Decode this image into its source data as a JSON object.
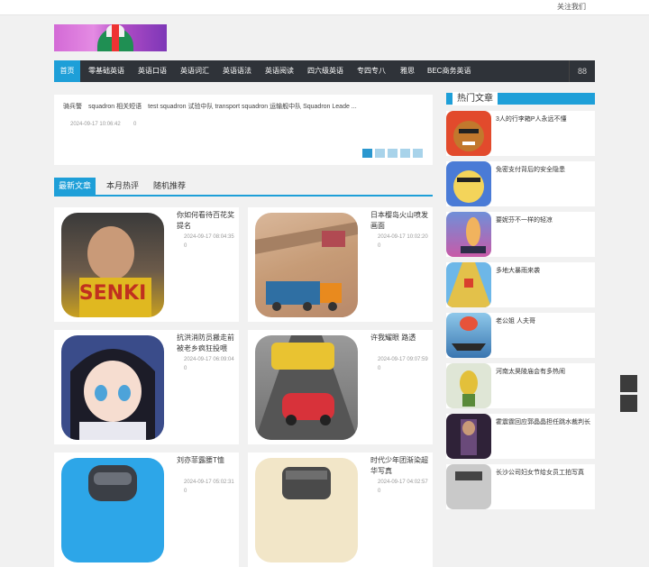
{
  "topbar": {
    "follow": "关注我们"
  },
  "nav": {
    "items": [
      "首页",
      "零基础英语",
      "英语口语",
      "英语词汇",
      "英语语法",
      "英语阅读",
      "四六级英语",
      "专四专八",
      "雅思",
      "BEC商务英语"
    ],
    "grid_icon": "grid-icon"
  },
  "slider": {
    "title": "骑兵警　squadron 相关短语　test squadron 试验中队 transport squadron 运输舰中队 Squadron Leade ...",
    "date": "2024-09-17 10:06:42",
    "count": "0",
    "dots": 5,
    "active_dot": 0
  },
  "tabs": [
    "最新文章",
    "本月热评",
    "随机推荐"
  ],
  "posts": [
    {
      "title": "你如何看待百花奖提名",
      "date": "2024-09-17 08:04:35",
      "count": "0"
    },
    {
      "title": "日本樱岛火山喷发画面",
      "date": "2024-09-17 10:02:20",
      "count": "0"
    },
    {
      "title": "抗洪消防员搬走前被老乡疯狂投喂",
      "date": "2024-09-17 06:09:04",
      "count": "0"
    },
    {
      "title": "许我耀眼 路透",
      "date": "2024-09-17 09:07:59",
      "count": "0"
    },
    {
      "title": "刘亦菲露腰T恤",
      "date": "2024-09-17 05:02:31",
      "count": "0"
    },
    {
      "title": "时代少年团渐染超华写真",
      "date": "2024-09-17 04:02:57",
      "count": "0"
    }
  ],
  "sidebar": {
    "heading": "热门文章",
    "items": [
      "3人的行李箱P人永远不懂",
      "免密支付背后的安全隐患",
      "要妮芬不一样的轻凉",
      "多地大暴雨来袭",
      "老公姐 人夫哥",
      "河南太昊陵庙会有多热闹",
      "霍震霆回应郭晶晶担任跳水裁判长",
      "长沙公司妇女节给女员工拍写真"
    ]
  },
  "colors": {
    "accent": "#1e9fd8",
    "nav_bg": "#2f3339",
    "page_bg": "#f1f1f1"
  }
}
